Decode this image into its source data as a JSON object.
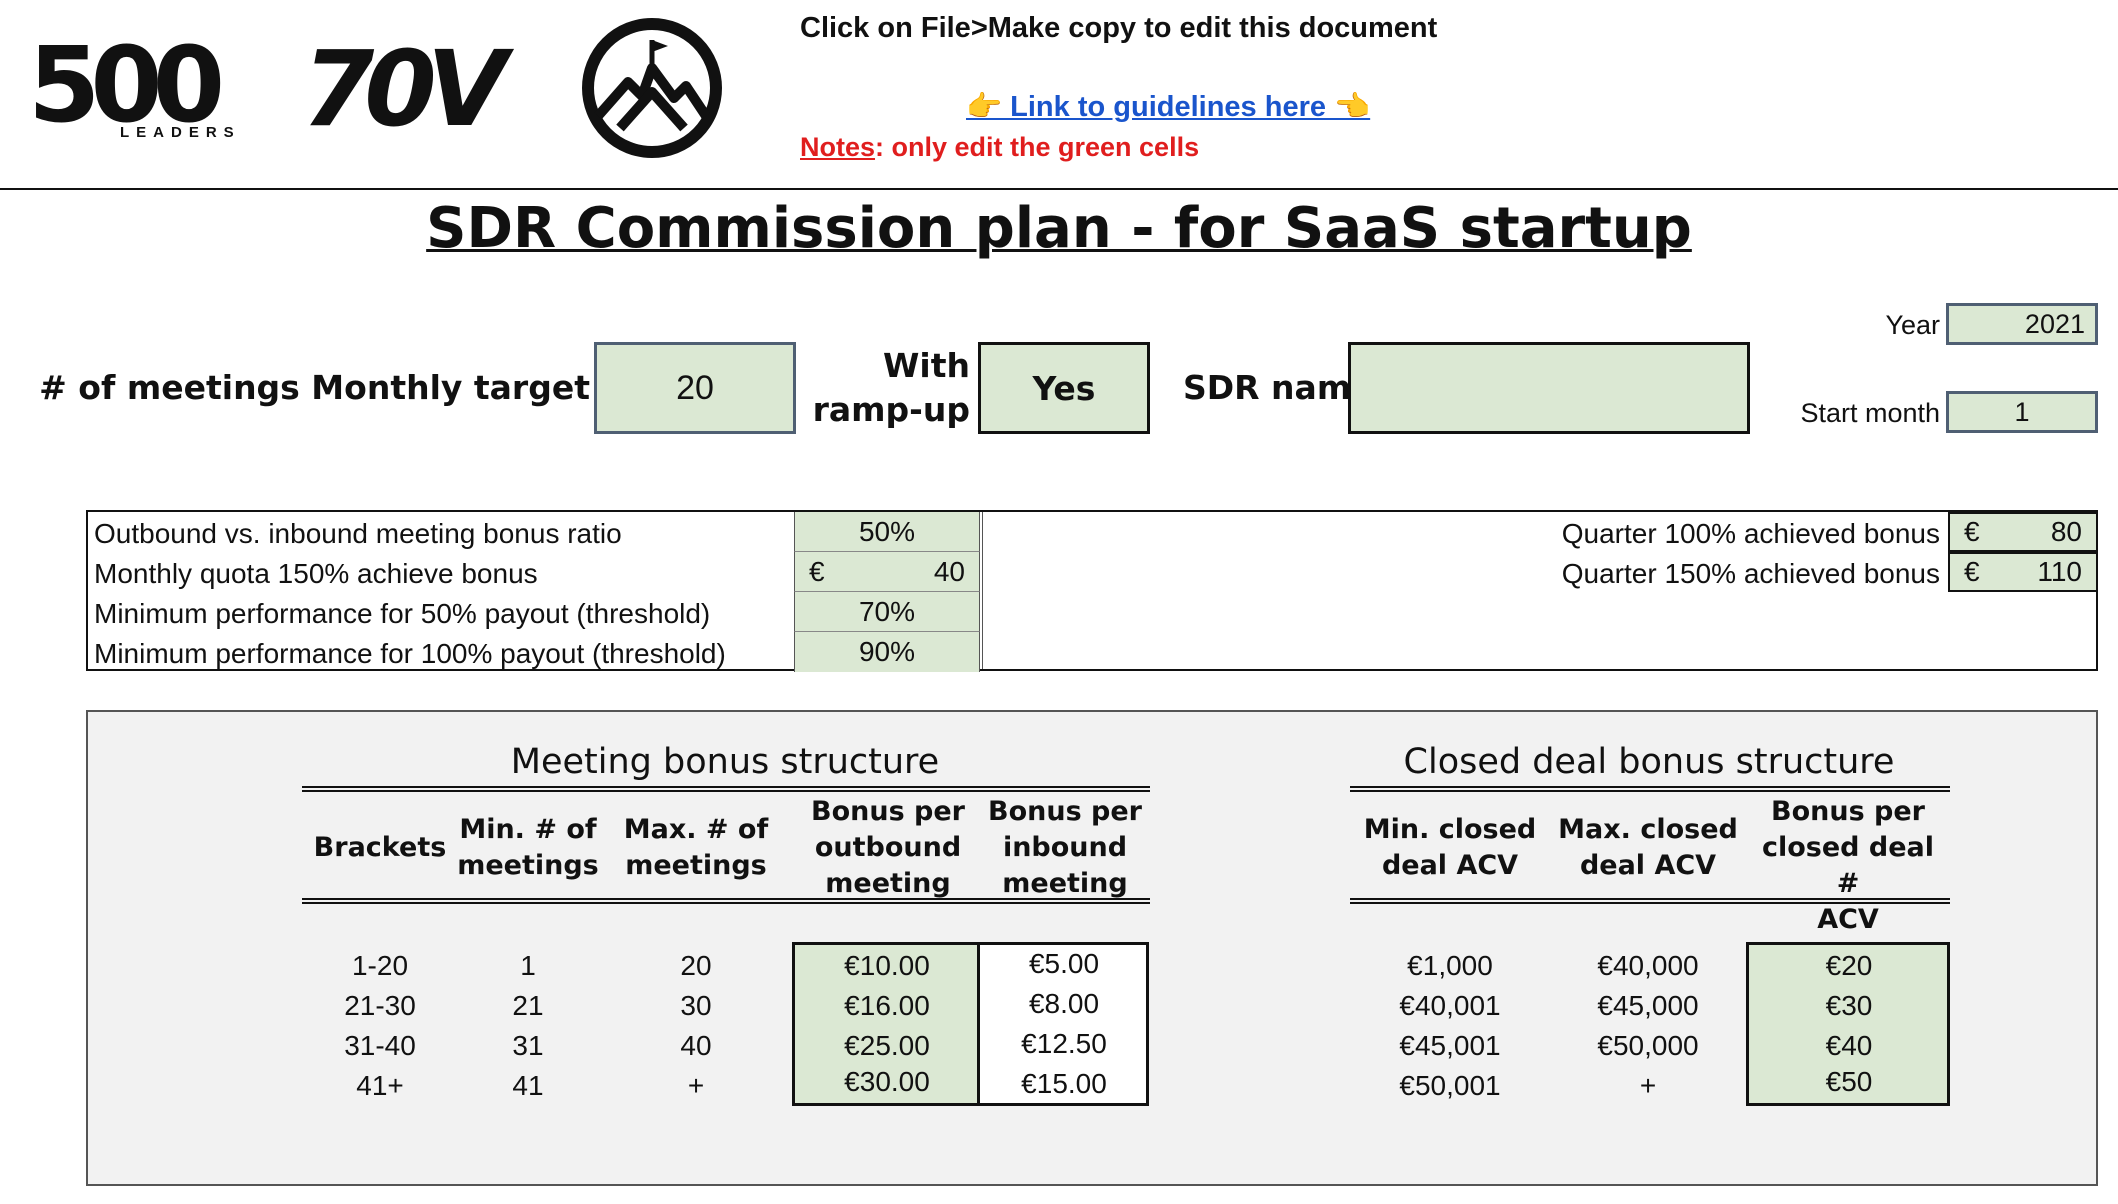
{
  "header": {
    "logos": [
      "500 LEADERS",
      "70V",
      "mountain-flag-logo"
    ],
    "logo_500_text": "500",
    "logo_500_sub": "LEADERS",
    "logo_70v_text": "70V",
    "instruction": "Click on File>Make copy to edit this document",
    "guidelines_link": "👉 Link to guidelines here 👈",
    "notes_label": "Notes",
    "notes_text": ": only edit the green cells"
  },
  "title": "SDR Commission plan - for SaaS startup",
  "inputs": {
    "monthly_target_label": "# of meetings Monthly target",
    "monthly_target_value": "20",
    "ramp_up_label_line1": "With",
    "ramp_up_label_line2": "ramp-up",
    "ramp_up_value": "Yes",
    "sdr_name_label": "SDR name",
    "sdr_name_value": "",
    "year_label": "Year",
    "year_value": "2021",
    "start_month_label": "Start month",
    "start_month_value": "1"
  },
  "params": {
    "rows": [
      {
        "label": "Outbound vs. inbound meeting bonus ratio",
        "currency": "",
        "value": "50%"
      },
      {
        "label": "Monthly quota 150% achieve bonus",
        "currency": "€",
        "value": "40"
      },
      {
        "label": "Minimum performance for 50% payout (threshold)",
        "currency": "",
        "value": "70%"
      },
      {
        "label": "Minimum performance for 100% payout (threshold)",
        "currency": "",
        "value": "90%"
      }
    ],
    "quarter": [
      {
        "label": "Quarter 100% achieved bonus",
        "currency": "€",
        "value": "80"
      },
      {
        "label": "Quarter 150% achieved bonus",
        "currency": "€",
        "value": "110"
      }
    ]
  },
  "meeting_bonus": {
    "title": "Meeting bonus structure",
    "headers": [
      [
        "Brackets"
      ],
      [
        "Min. # of",
        "meetings"
      ],
      [
        "Max. # of",
        "meetings"
      ],
      [
        "Bonus per",
        "outbound",
        "meeting"
      ],
      [
        "Bonus per",
        "inbound",
        "meeting"
      ]
    ],
    "rows": [
      {
        "bracket": "1-20",
        "min": "1",
        "max": "20",
        "outbound": "€10.00",
        "inbound": "€5.00"
      },
      {
        "bracket": "21-30",
        "min": "21",
        "max": "30",
        "outbound": "€16.00",
        "inbound": "€8.00"
      },
      {
        "bracket": "31-40",
        "min": "31",
        "max": "40",
        "outbound": "€25.00",
        "inbound": "€12.50"
      },
      {
        "bracket": "41+",
        "min": "41",
        "max": "+",
        "outbound": "€30.00",
        "inbound": "€15.00"
      }
    ]
  },
  "deal_bonus": {
    "title": "Closed deal bonus structure",
    "headers": [
      [
        "Min. closed",
        "deal ACV"
      ],
      [
        "Max. closed",
        "deal ACV"
      ],
      [
        "Bonus per",
        "closed deal #",
        "ACV"
      ]
    ],
    "rows": [
      {
        "min": "€1,000",
        "max": "€40,000",
        "bonus": "€20"
      },
      {
        "min": "€40,001",
        "max": "€45,000",
        "bonus": "€30"
      },
      {
        "min": "€45,001",
        "max": "€50,000",
        "bonus": "€40"
      },
      {
        "min": "€50,001",
        "max": "+",
        "bonus": "€50"
      }
    ]
  },
  "colors": {
    "editable_green": "#dbe8d3",
    "panel_grey": "#f2f2f2",
    "link_blue": "#1a55cc",
    "note_red": "#e01e1e",
    "slate_border": "#4f5f73"
  }
}
